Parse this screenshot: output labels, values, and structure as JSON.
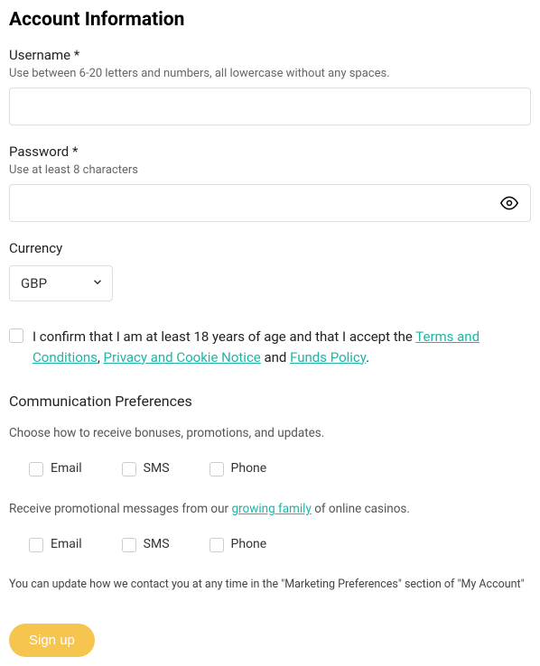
{
  "heading": "Account Information",
  "username": {
    "label": "Username *",
    "hint": "Use between 6-20 letters and numbers, all lowercase without any spaces."
  },
  "password": {
    "label": "Password *",
    "hint": "Use at least 8 characters"
  },
  "currency": {
    "label": "Currency",
    "value": "GBP"
  },
  "consent": {
    "prefix": "I confirm that I am at least 18 years of age and that I accept the ",
    "terms": "Terms and Conditions",
    "sep1": ", ",
    "privacy": "Privacy and Cookie Notice",
    "sep2": " and ",
    "funds": "Funds Policy",
    "suffix": "."
  },
  "comm": {
    "title": "Communication Preferences",
    "hint": "Choose how to receive bonuses, promotions, and updates.",
    "email": "Email",
    "sms": "SMS",
    "phone": "Phone"
  },
  "promo": {
    "prefix": "Receive promotional messages from our ",
    "link": "growing family",
    "suffix": " of online casinos."
  },
  "footnote": "You can update how we contact you at any time in the \"Marketing Preferences\" section of \"My Account\"",
  "signup": "Sign up"
}
